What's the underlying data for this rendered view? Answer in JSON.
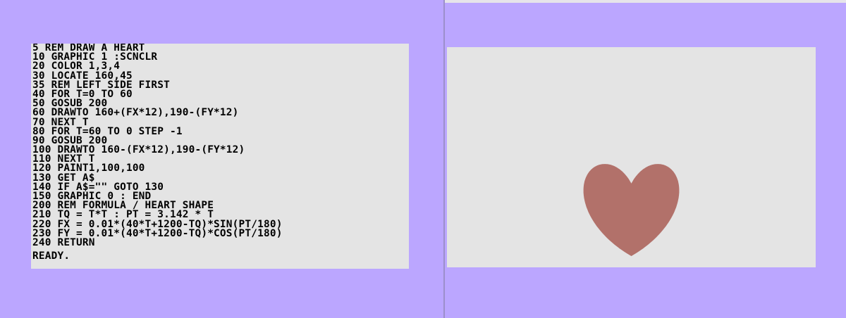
{
  "colors": {
    "border": "#bba6ff",
    "paper": "#e4e4e4",
    "ink": "#000000",
    "heart": "#b2716a"
  },
  "program": {
    "lines": [
      "5 REM DRAW A HEART",
      "10 GRAPHIC 1 :SCNCLR",
      "20 COLOR 1,3,4",
      "30 LOCATE 160,45",
      "35 REM LEFT SIDE FIRST",
      "40 FOR T=0 TO 60",
      "50 GOSUB 200",
      "60 DRAWTO 160+(FX*12),190-(FY*12)",
      "70 NEXT T",
      "80 FOR T=60 TO 0 STEP -1",
      "90 GOSUB 200",
      "100 DRAWTO 160-(FX*12),190-(FY*12)",
      "110 NEXT T",
      "120 PAINT1,100,100",
      "130 GET A$",
      "140 IF A$=\"\" GOTO 130",
      "150 GRAPHIC 0 : END",
      "200 REM FORMULA / HEART SHAPE",
      "210 TQ = T*T : PT = 3.142 * T",
      "220 FX = 0.01*(40*T+1200-TQ)*SIN(PT/180)",
      "230 FY = 0.01*(40*T+1200-TQ)*COS(PT/180)",
      "240 RETURN"
    ],
    "prompt": "READY."
  },
  "graphics": {
    "shape_icon": "heart-shape"
  }
}
